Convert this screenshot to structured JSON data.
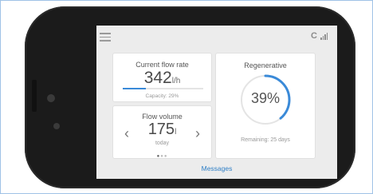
{
  "header": {
    "connection_letter": "C",
    "signal_icon": "signal-bars-icon",
    "menu_icon": "hamburger-icon"
  },
  "flow_rate": {
    "title": "Current flow rate",
    "value": "342",
    "unit": "l/h",
    "capacity_label": "Capacity: 29%",
    "capacity_fraction": 0.29
  },
  "flow_volume": {
    "title": "Flow volume",
    "value": "175",
    "unit": "l",
    "period": "today",
    "prev_icon": "chevron-left-icon",
    "next_icon": "chevron-right-icon",
    "page_count": 3,
    "active_page": 1
  },
  "regenerative": {
    "title": "Regenerative",
    "percent_label": "39%",
    "fraction": 0.39,
    "remaining_label": "Remaining: 25 days"
  },
  "footer": {
    "messages_label": "Messages"
  },
  "colors": {
    "accent": "#3a8ad8",
    "track": "#e4e4e4",
    "phone_body": "#1b1b1b"
  }
}
